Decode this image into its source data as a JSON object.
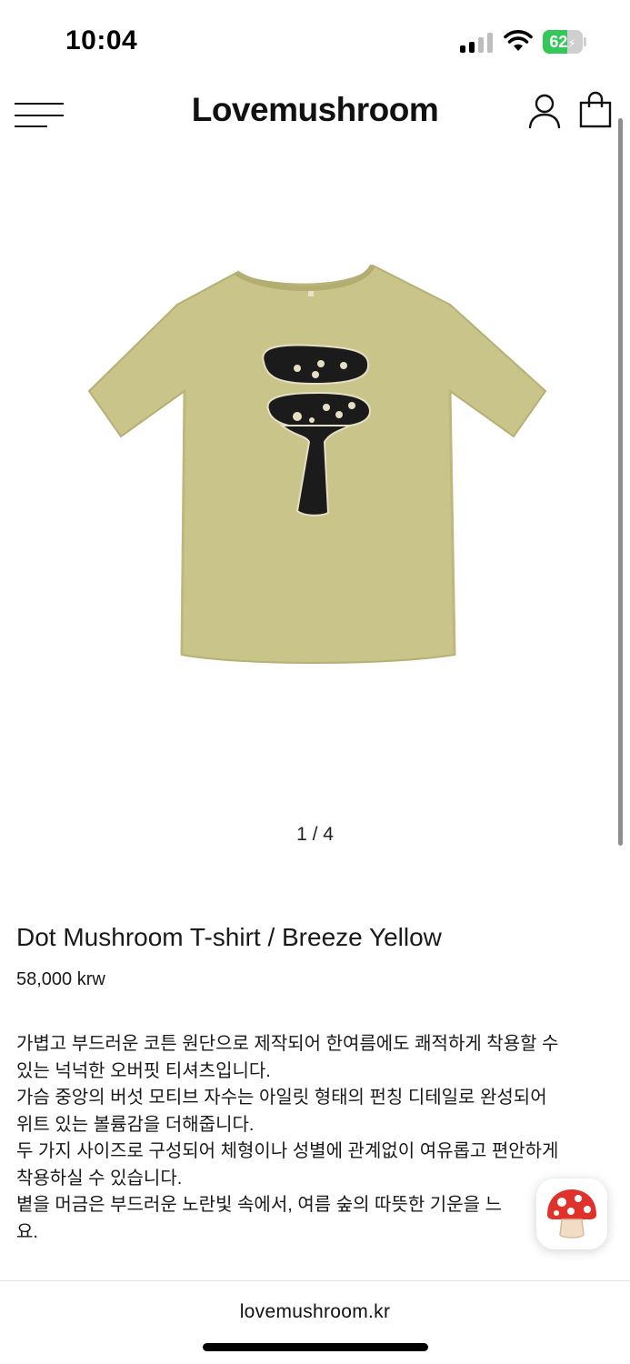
{
  "status_bar": {
    "time": "10:04",
    "battery_level": "62",
    "battery_percent": 62,
    "battery_charging": true,
    "icons": [
      "signal-icon",
      "wifi-icon",
      "battery-icon"
    ]
  },
  "header": {
    "logo": "Lovemushroom",
    "icons": [
      "menu-icon",
      "user-icon",
      "shopping-bag-icon"
    ]
  },
  "gallery": {
    "pager": "1 / 4",
    "image_colors": {
      "shirt": "#c9c48a",
      "print": "#1b1b1b",
      "dots": "#e6dfc5"
    }
  },
  "product": {
    "title": "Dot Mushroom T-shirt / Breeze Yellow",
    "price": "58,000 krw",
    "description_lines": [
      "가볍고 부드러운 코튼 원단으로 제작되어 한여름에도 쾌적하게 착용할 수",
      "있는 넉넉한 오버핏 티셔츠입니다.",
      "가슴 중앙의 버섯 모티브 자수는 아일릿 형태의 펀칭 디테일로 완성되어",
      "위트 있는 볼륨감을 더해줍니다.",
      "두 가지 사이즈로 구성되어 체형이나 성별에 관계없이 여유롭고 편안하게",
      "착용하실 수 있습니다.",
      "볕을 머금은 부드러운 노란빛 속에서, 여름 숲의 따뜻한 기운을 느",
      "요."
    ]
  },
  "chat_button": {
    "icon": "mushroom-icon"
  },
  "footer": {
    "domain": "lovemushroom.kr"
  }
}
